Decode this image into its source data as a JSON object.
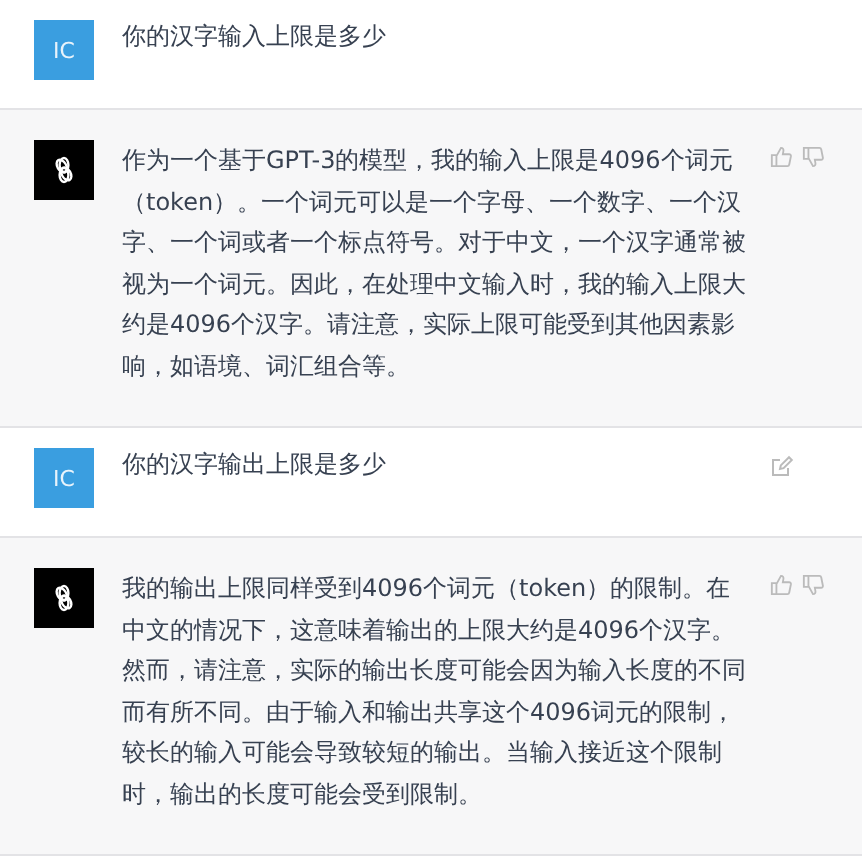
{
  "messages": [
    {
      "kind": "user",
      "avatar": "IC",
      "text": "你的汉字输入上限是多少",
      "edit_icon": false
    },
    {
      "kind": "assistant",
      "text": "作为一个基于GPT-3的模型，我的输入上限是4096个词元（token）。一个词元可以是一个字母、一个数字、一个汉字、一个词或者一个标点符号。对于中文，一个汉字通常被视为一个词元。因此，在处理中文输入时，我的输入上限大约是4096个汉字。请注意，实际上限可能受到其他因素影响，如语境、词汇组合等。"
    },
    {
      "kind": "user",
      "avatar": "IC",
      "text": "你的汉字输出上限是多少",
      "edit_icon": true
    },
    {
      "kind": "assistant",
      "text": "我的输出上限同样受到4096个词元（token）的限制。在中文的情况下，这意味着输出的上限大约是4096个汉字。然而，请注意，实际的输出长度可能会因为输入长度的不同而有所不同。由于输入和输出共享这个4096词元的限制，较长的输入可能会导致较短的输出。当输入接近这个限制时，输出的长度可能会受到限制。"
    }
  ]
}
